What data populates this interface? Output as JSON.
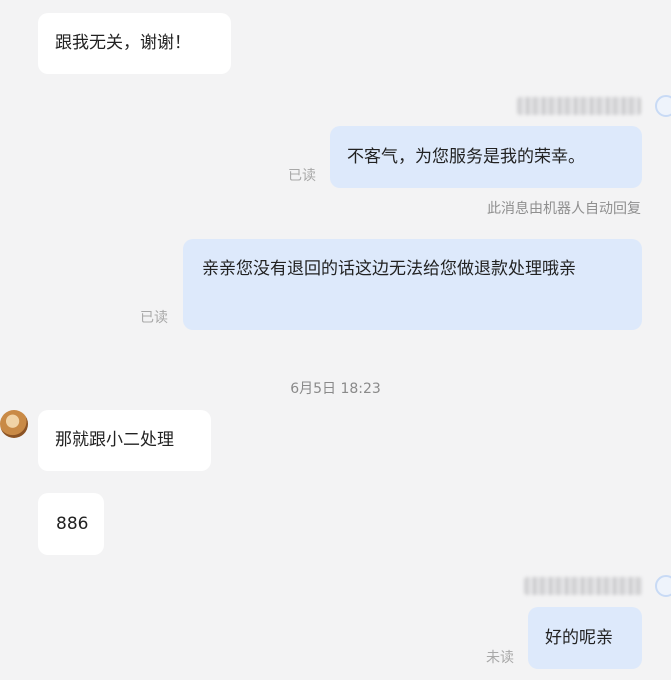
{
  "messages": {
    "m1": {
      "text": "跟我无关，谢谢！"
    },
    "m2": {
      "text": "不客气，为您服务是我的荣幸。",
      "status": "已读",
      "notice": "此消息由机器人自动回复"
    },
    "m3": {
      "text": "亲亲您没有退回的话这边无法给您做退款处理哦亲",
      "status": "已读"
    },
    "timestamp": "6月5日 18:23",
    "m4": {
      "text": "那就跟小二处理"
    },
    "m5": {
      "text": "886"
    },
    "m6": {
      "text": "好的呢亲",
      "status": "未读"
    }
  },
  "colors": {
    "incoming_bubble": "#ffffff",
    "outgoing_bubble": "#dde9fb",
    "background": "#f3f3f4"
  }
}
